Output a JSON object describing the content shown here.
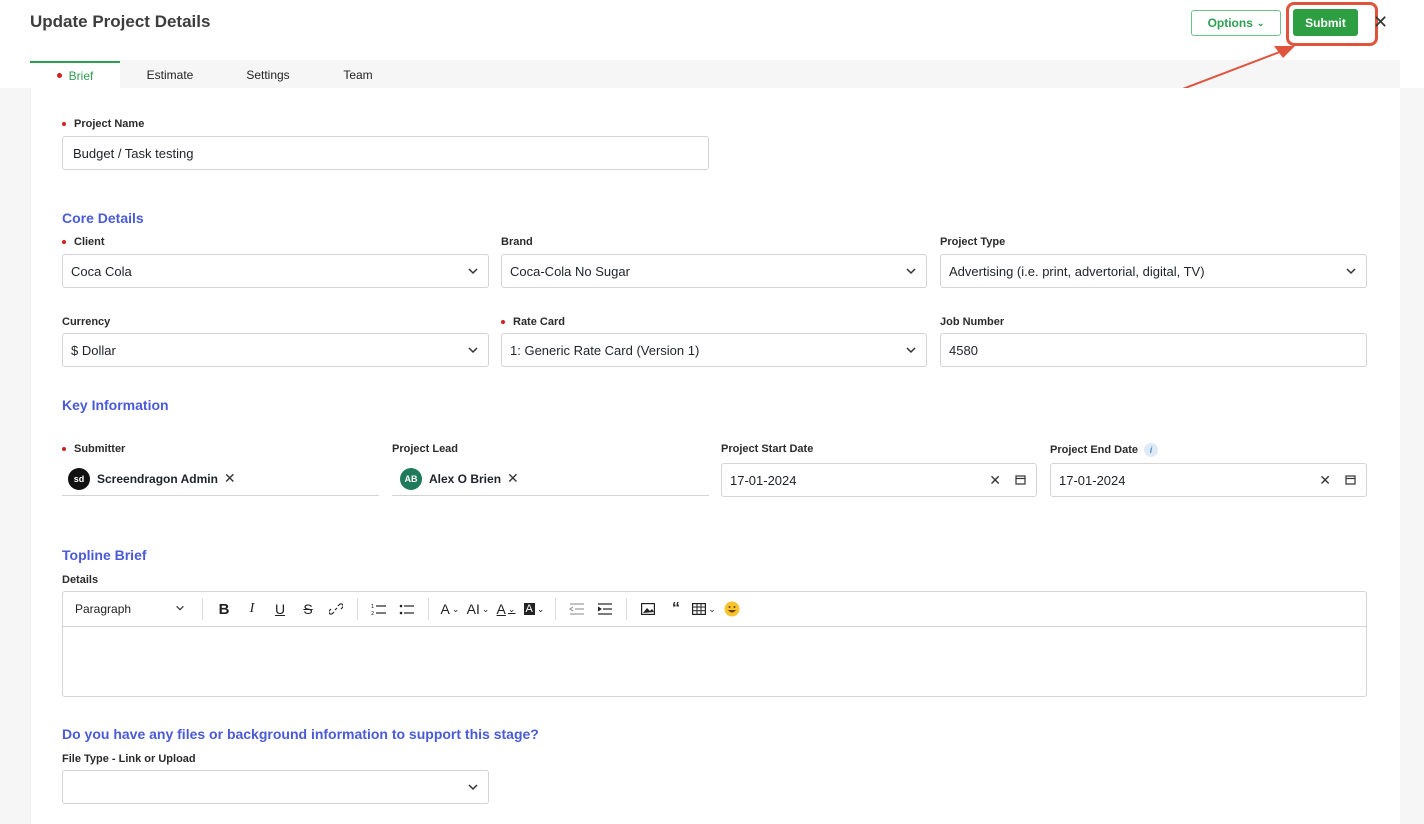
{
  "header": {
    "title": "Update Project Details",
    "options_label": "Options",
    "submit_label": "Submit",
    "close_icon": "close-icon"
  },
  "tabs": [
    {
      "label": "Brief",
      "active": true,
      "required": true
    },
    {
      "label": "Estimate"
    },
    {
      "label": "Settings"
    },
    {
      "label": "Team"
    }
  ],
  "project_name": {
    "label": "Project Name",
    "value": "Budget / Task testing"
  },
  "core_details": {
    "heading": "Core Details",
    "client": {
      "label": "Client",
      "value": "Coca Cola"
    },
    "brand": {
      "label": "Brand",
      "value": "Coca-Cola No Sugar"
    },
    "project_type": {
      "label": "Project Type",
      "value": "Advertising (i.e. print, advertorial, digital, TV)"
    },
    "currency": {
      "label": "Currency",
      "value": "$ Dollar"
    },
    "rate_card": {
      "label": "Rate Card",
      "value": "1: Generic Rate Card (Version 1)"
    },
    "job_number": {
      "label": "Job Number",
      "value": "4580"
    }
  },
  "key_information": {
    "heading": "Key Information",
    "submitter": {
      "label": "Submitter",
      "name": "Screendragon Admin",
      "initials": "sd"
    },
    "project_lead": {
      "label": "Project Lead",
      "name": "Alex O Brien",
      "initials": "AB"
    },
    "start_date": {
      "label": "Project Start Date",
      "value": "17-01-2024"
    },
    "end_date": {
      "label": "Project End Date",
      "value": "17-01-2024"
    }
  },
  "topline_brief": {
    "heading": "Topline Brief",
    "details_label": "Details",
    "paragraph_label": "Paragraph"
  },
  "files": {
    "heading": "Do you have any files or background information to support this stage?",
    "file_type_label": "File Type - Link or Upload",
    "file_type_value": ""
  },
  "colors": {
    "accent_green": "#2e9e42",
    "section_blue": "#4a5bd8",
    "required_red": "#d52020",
    "highlight_red": "#e0533d"
  }
}
